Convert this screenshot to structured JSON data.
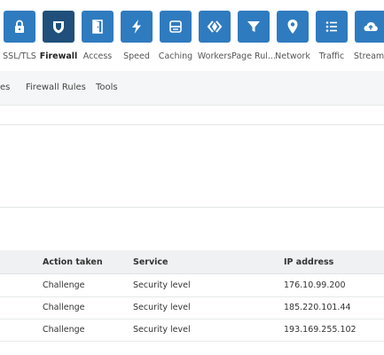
{
  "nav": {
    "items": [
      {
        "label": "SSL/TLS",
        "icon": "lock-icon"
      },
      {
        "label": "Firewall",
        "icon": "shield-icon",
        "active": true
      },
      {
        "label": "Access",
        "icon": "door-icon"
      },
      {
        "label": "Speed",
        "icon": "lightning-icon"
      },
      {
        "label": "Caching",
        "icon": "server-icon"
      },
      {
        "label": "Workers",
        "icon": "workers-icon"
      },
      {
        "label": "Page Rul...",
        "icon": "filter-icon"
      },
      {
        "label": "Network",
        "icon": "location-pin-icon"
      },
      {
        "label": "Traffic",
        "icon": "list-icon"
      },
      {
        "label": "Stream",
        "icon": "cloud-upload-icon"
      }
    ],
    "accent": "#2f7bbf",
    "active_color": "#1f4f7a"
  },
  "subnav": {
    "items": [
      "es",
      "Firewall Rules",
      "Tools"
    ]
  },
  "table": {
    "columns": [
      "Action taken",
      "Service",
      "IP address"
    ],
    "rows": [
      [
        "Challenge",
        "Security level",
        "176.10.99.200"
      ],
      [
        "Challenge",
        "Security level",
        "185.220.101.44"
      ],
      [
        "Challenge",
        "Security level",
        "193.169.255.102"
      ]
    ]
  }
}
